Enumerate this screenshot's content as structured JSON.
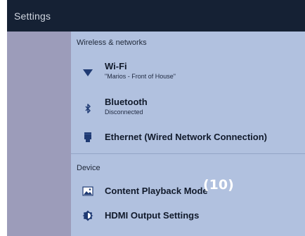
{
  "header": {
    "title": "Settings"
  },
  "sections": {
    "wireless": {
      "title": "Wireless & networks",
      "wifi": {
        "label": "Wi-Fi",
        "status": "\"Marios - Front of House\"",
        "icon": "wifi-icon"
      },
      "bluetooth": {
        "label": "Bluetooth",
        "status": "Disconnected",
        "icon": "bluetooth-icon"
      },
      "ethernet": {
        "label": "Ethernet (Wired Network Connection)",
        "icon": "ethernet-icon"
      }
    },
    "device": {
      "title": "Device",
      "content_playback": {
        "label": "Content Playback Mode",
        "icon": "image-icon"
      },
      "hdmi": {
        "label": "HDMI Output Settings",
        "icon": "brightness-icon"
      }
    }
  },
  "annotation": {
    "text": "(10)"
  },
  "colors": {
    "topbar": "#152134",
    "sidebar": "#9c9cba",
    "content": "#b1c1df",
    "icon": "#1f3a73"
  }
}
